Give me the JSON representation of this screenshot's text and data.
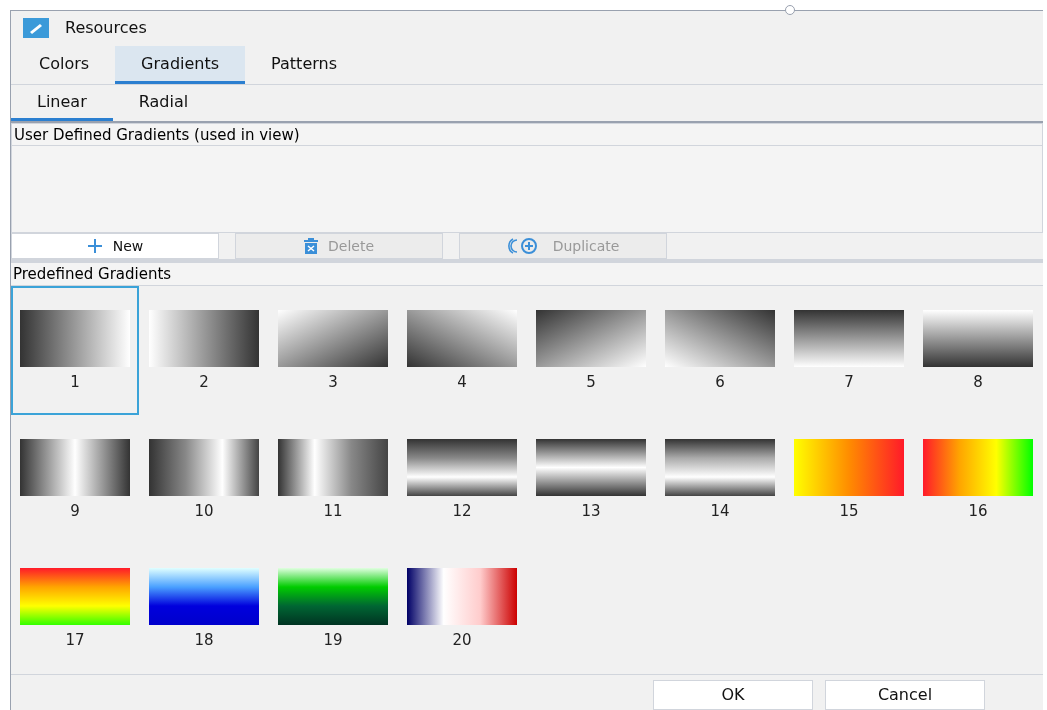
{
  "window": {
    "title": "Resources"
  },
  "tabs": [
    {
      "label": "Colors",
      "selected": false
    },
    {
      "label": "Gradients",
      "selected": true
    },
    {
      "label": "Patterns",
      "selected": false
    }
  ],
  "subtabs": [
    {
      "label": "Linear",
      "selected": true
    },
    {
      "label": "Radial",
      "selected": false
    }
  ],
  "user_defined": {
    "title": "User Defined Gradients (used in view)"
  },
  "actions": [
    {
      "kind": "new",
      "label": "New",
      "disabled": false
    },
    {
      "kind": "delete",
      "label": "Delete",
      "disabled": true
    },
    {
      "kind": "duplicate",
      "label": "Duplicate",
      "disabled": true
    }
  ],
  "predefined": {
    "title": "Predefined Gradients",
    "items": [
      {
        "label": "1",
        "selected": true,
        "kind": "darklight"
      },
      {
        "label": "2",
        "selected": false,
        "kind": "lightdark"
      },
      {
        "label": "3",
        "selected": false,
        "kind": "diagdown"
      },
      {
        "label": "4",
        "selected": false,
        "kind": "diagup"
      },
      {
        "label": "5",
        "selected": false,
        "kind": "diagdownrev"
      },
      {
        "label": "6",
        "selected": false,
        "kind": "diaguprev"
      },
      {
        "label": "7",
        "selected": false,
        "kind": "topdark"
      },
      {
        "label": "8",
        "selected": false,
        "kind": "toplight"
      },
      {
        "label": "9",
        "selected": false,
        "kind": "vband"
      },
      {
        "label": "10",
        "selected": false,
        "kind": "vbandright"
      },
      {
        "label": "11",
        "selected": false,
        "kind": "vbandleft"
      },
      {
        "label": "12",
        "selected": false,
        "kind": "hbandlow"
      },
      {
        "label": "13",
        "selected": false,
        "kind": "hband"
      },
      {
        "label": "14",
        "selected": false,
        "kind": "hbandlower"
      },
      {
        "label": "15",
        "selected": false,
        "kind": "yellowred"
      },
      {
        "label": "16",
        "selected": false,
        "kind": "rainbow"
      },
      {
        "label": "17",
        "selected": false,
        "kind": "rainbowvertical"
      },
      {
        "label": "18",
        "selected": false,
        "kind": "sky"
      },
      {
        "label": "19",
        "selected": false,
        "kind": "forest"
      },
      {
        "label": "20",
        "selected": false,
        "kind": "flag"
      }
    ]
  },
  "buttons": [
    {
      "label": "OK"
    },
    {
      "label": "Cancel"
    }
  ]
}
